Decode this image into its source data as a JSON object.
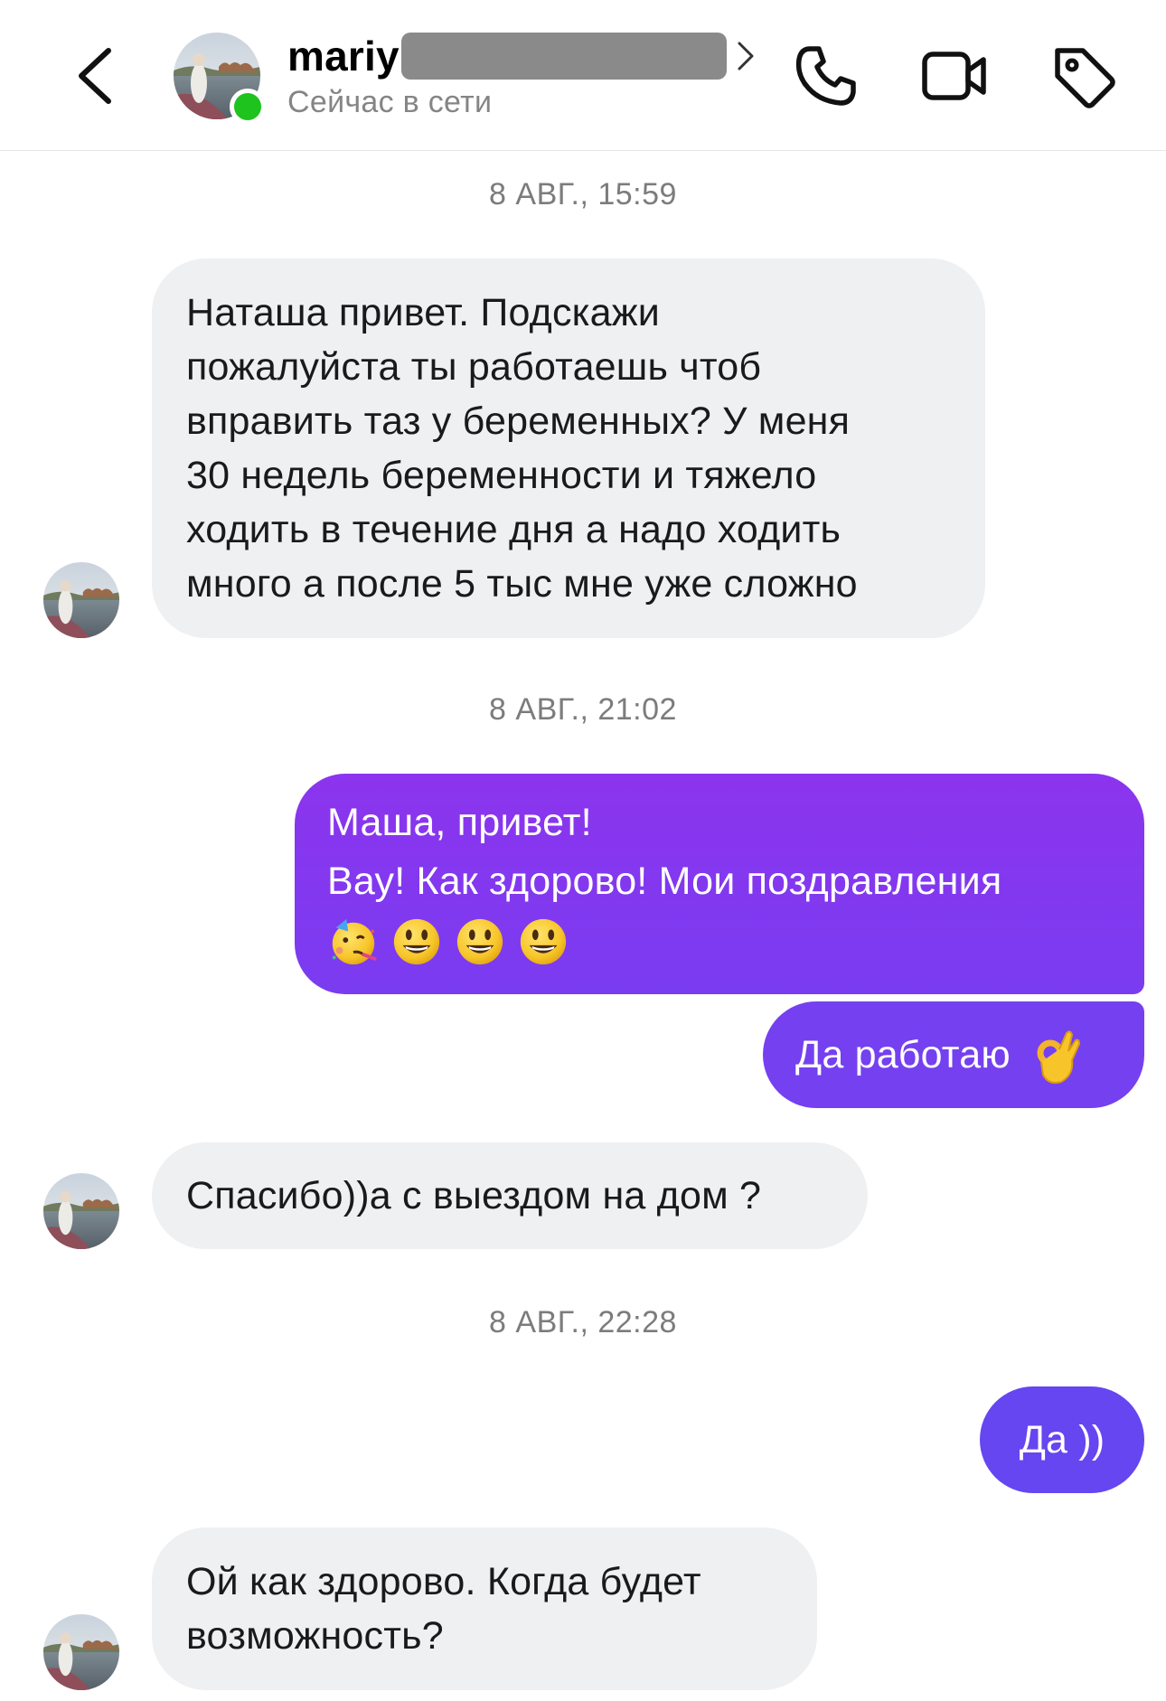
{
  "header": {
    "contact_name": "mariy",
    "status": "Сейчас в сети",
    "back_icon": "chevron-left-icon",
    "call_icon": "phone-icon",
    "video_icon": "video-camera-icon",
    "tag_icon": "tag-icon",
    "online_color": "#1ec31e"
  },
  "colors": {
    "outgoing_top": "#8b34ee",
    "outgoing_bottom": "#6145f0",
    "incoming": "#eff0f2"
  },
  "messages": [
    {
      "type": "timestamp",
      "text": "8 АВГ., 15:59"
    },
    {
      "type": "incoming",
      "lines": [
        "Наташа привет. Подскажи",
        "пожалуйста ты работаешь чтоб",
        "вправить таз у беременных?  У меня",
        "30 недель беременности и тяжело",
        "ходить в течение дня а надо ходить",
        "много а после 5 тыс мне уже сложно"
      ]
    },
    {
      "type": "timestamp",
      "text": "8 АВГ., 21:02"
    },
    {
      "type": "outgoing",
      "lines": [
        "Маша, привет!",
        "Вау! Как здорово! Мои поздравления"
      ],
      "emojis": [
        "partying-face-emoji",
        "smiley-face-emoji",
        "smiley-face-emoji",
        "smiley-face-emoji"
      ]
    },
    {
      "type": "outgoing",
      "text": "Да работаю",
      "emoji": "ok-hand-emoji"
    },
    {
      "type": "incoming",
      "text": "Спасибо))а с выездом на дом ?"
    },
    {
      "type": "timestamp",
      "text": "8 АВГ., 22:28"
    },
    {
      "type": "outgoing",
      "text": "Да ))"
    },
    {
      "type": "incoming",
      "lines": [
        "Ой как здорово. Когда будет",
        "возможность?"
      ]
    }
  ]
}
